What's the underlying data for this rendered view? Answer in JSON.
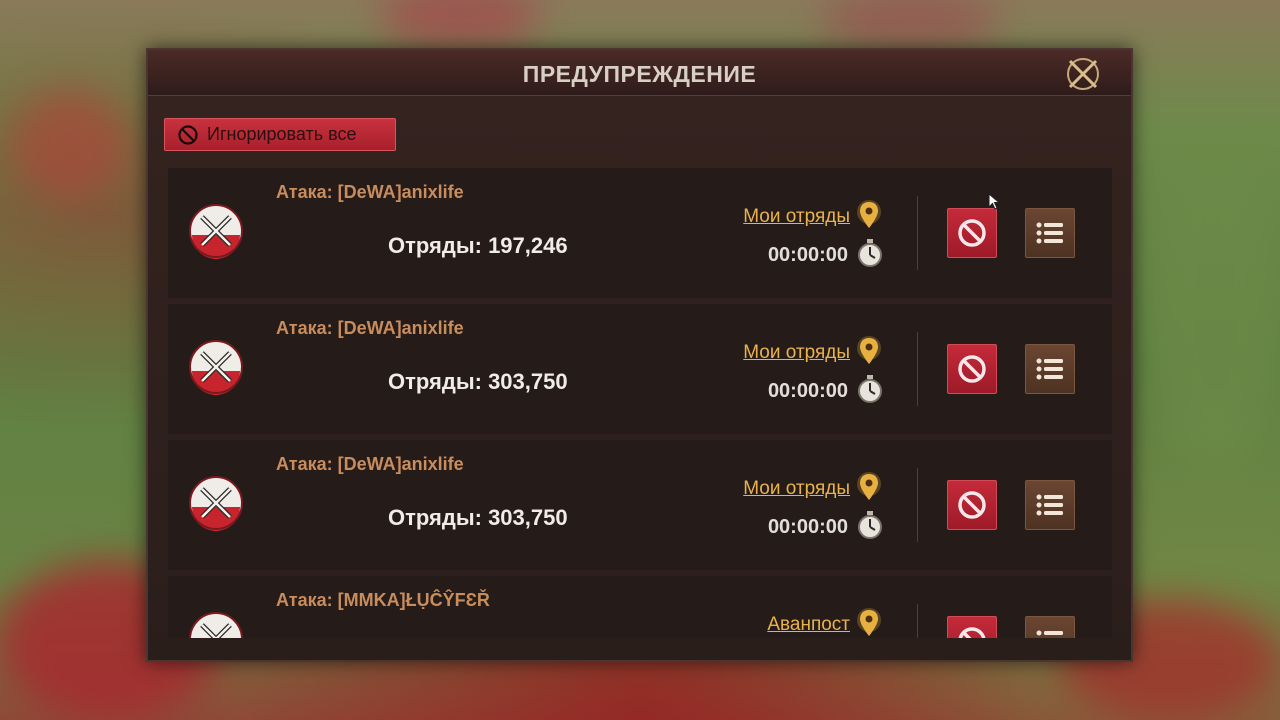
{
  "dialog": {
    "title": "ПРЕДУПРЕЖДЕНИЕ",
    "close_icon": "crossed-swords-close-icon",
    "ignore_all_label": "Игнорировать все"
  },
  "attacks": [
    {
      "attacker": "Атака: [DeWA]anixlife",
      "troops": "Отряды: 197,246",
      "target": "Мои отряды",
      "timer": "00:00:00"
    },
    {
      "attacker": "Атака: [DeWA]anixlife",
      "troops": "Отряды: 303,750",
      "target": "Мои отряды",
      "timer": "00:00:00"
    },
    {
      "attacker": "Атака: [DeWA]anixlife",
      "troops": "Отряды: 303,750",
      "target": "Мои отряды",
      "timer": "00:00:00"
    },
    {
      "attacker": "Атака: [MMKA]ŁỤĈŶFƐŘ",
      "troops": "",
      "target": "Аванпост",
      "timer": ""
    }
  ],
  "colors": {
    "accent_red": "#c42a3a",
    "target_gold": "#e9b24a",
    "attacker_orange": "#c98c5c"
  }
}
